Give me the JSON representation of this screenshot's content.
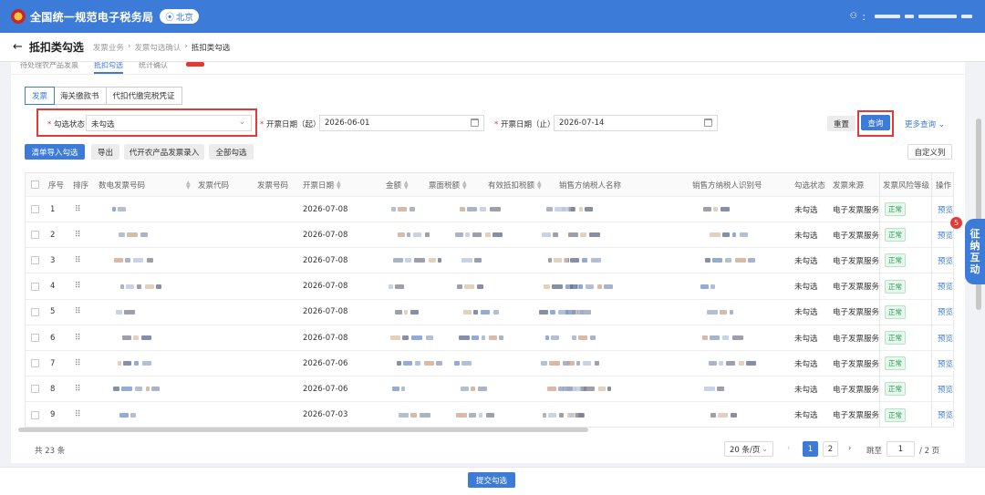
{
  "header": {
    "title": "全国统一规范电子税务局",
    "region": "北京",
    "user_prefix": "："
  },
  "page": {
    "back": "←",
    "title": "抵扣类勾选",
    "breadcrumb": [
      "发票业务",
      "发票勾选确认",
      "抵扣类勾选"
    ],
    "sep": "›"
  },
  "top_tabs": [
    "待处理农产品发票",
    "抵扣勾选",
    "统计确认"
  ],
  "invoice_types": [
    "发票",
    "海关缴款书",
    "代扣代缴完税凭证"
  ],
  "filters": {
    "status_label": "勾选状态",
    "status_value": "未勾选",
    "date_from_label": "开票日期（起）",
    "date_from": "2026-06-01",
    "date_to_label": "开票日期（止）",
    "date_to": "2026-07-14",
    "req": "*"
  },
  "buttons": {
    "reset": "重置",
    "query": "查询",
    "more": "更多查询",
    "import": "清单导入勾选",
    "export": "导出",
    "agri": "代开农产品发票录入",
    "select_all": "全部勾选",
    "custom_cols": "自定义列",
    "submit": "提交勾选"
  },
  "table": {
    "columns": [
      "序号",
      "排序",
      "数电发票号码",
      "发票代码",
      "发票号码",
      "开票日期",
      "金额",
      "票面税额",
      "有效抵扣税额",
      "销售方纳税人名称",
      "销售方纳税人识别号",
      "勾选状态",
      "发票来源",
      "发票风险等级",
      "操作"
    ],
    "rows": [
      {
        "no": "1",
        "date": "2026-07-08",
        "status": "未勾选",
        "source": "电子发票服务",
        "risk": "正常",
        "action": "预览"
      },
      {
        "no": "2",
        "date": "2026-07-08",
        "status": "未勾选",
        "source": "电子发票服务",
        "risk": "正常",
        "action": "预览"
      },
      {
        "no": "3",
        "date": "2026-07-08",
        "status": "未勾选",
        "source": "电子发票服务",
        "risk": "正常",
        "action": "预览"
      },
      {
        "no": "4",
        "date": "2026-07-08",
        "status": "未勾选",
        "source": "电子发票服务",
        "risk": "正常",
        "action": "预览"
      },
      {
        "no": "5",
        "date": "2026-07-08",
        "status": "未勾选",
        "source": "电子发票服务",
        "risk": "正常",
        "action": "预览"
      },
      {
        "no": "6",
        "date": "2026-07-08",
        "status": "未勾选",
        "source": "电子发票服务",
        "risk": "正常",
        "action": "预览"
      },
      {
        "no": "7",
        "date": "2026-07-06",
        "status": "未勾选",
        "source": "电子发票服务",
        "risk": "正常",
        "action": "预览"
      },
      {
        "no": "8",
        "date": "2026-07-06",
        "status": "未勾选",
        "source": "电子发票服务",
        "risk": "正常",
        "action": "预览"
      },
      {
        "no": "9",
        "date": "2026-07-03",
        "status": "未勾选",
        "source": "电子发票服务",
        "risk": "正常",
        "action": "预览"
      }
    ]
  },
  "pagination": {
    "total": "共 23 条",
    "page_size": "20 条/页",
    "pages": [
      "1",
      "2"
    ],
    "prev": "‹",
    "next": "›",
    "goto_label": "跳至",
    "goto_value": "1",
    "page_count": "/ 2 页"
  },
  "side": {
    "badge": "5",
    "chars": [
      "征",
      "纳",
      "互",
      "动"
    ]
  },
  "icons": {
    "region": "location-pin-icon",
    "back": "arrow-left-icon",
    "calendar": "calendar-icon",
    "dropdown": "chevron-down-icon",
    "drag": "drag-handle-icon"
  }
}
